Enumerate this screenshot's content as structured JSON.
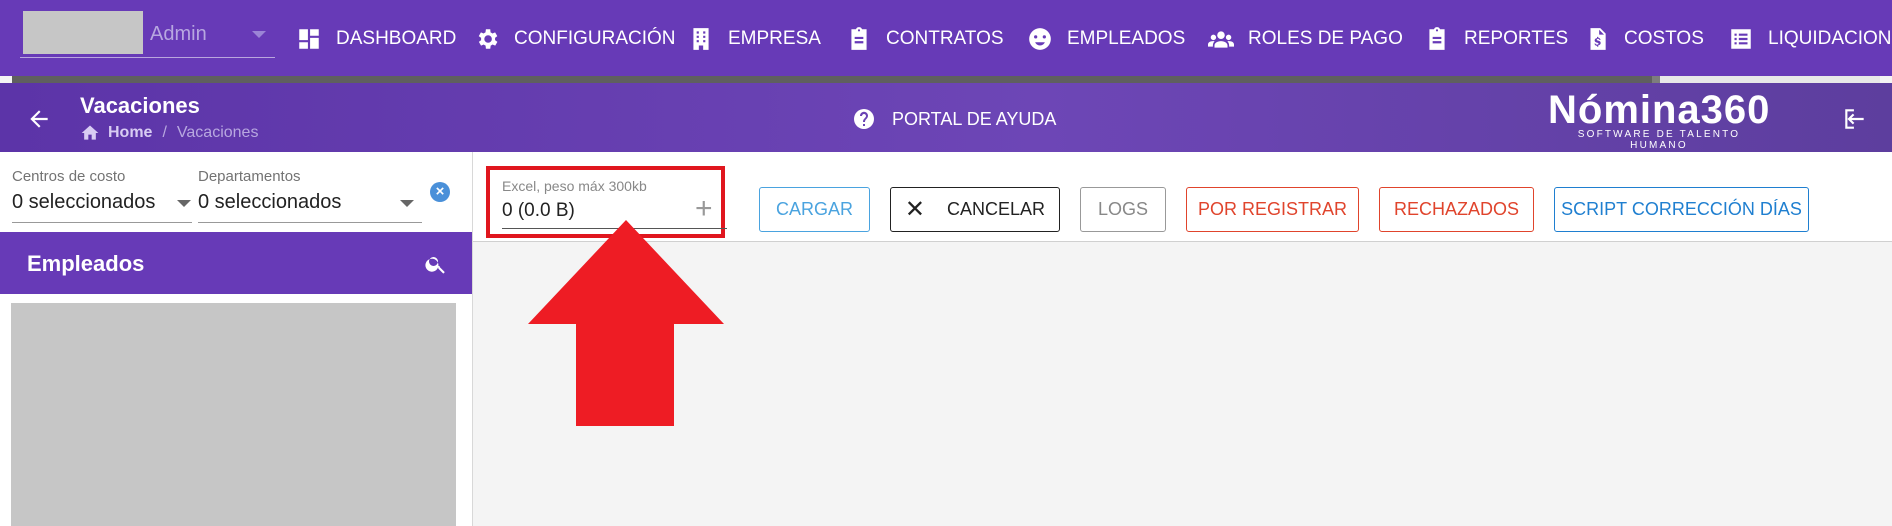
{
  "topnav": {
    "user_name": "Admin",
    "items": [
      {
        "label": "DASHBOARD",
        "icon": "dashboard-icon"
      },
      {
        "label": "CONFIGURACIÓN",
        "icon": "gear-icon"
      },
      {
        "label": "EMPRESA",
        "icon": "building-icon"
      },
      {
        "label": "CONTRATOS",
        "icon": "clipboard-icon"
      },
      {
        "label": "EMPLEADOS",
        "icon": "face-icon"
      },
      {
        "label": "ROLES DE PAGO",
        "icon": "group-icon"
      },
      {
        "label": "REPORTES",
        "icon": "clipboard-icon"
      },
      {
        "label": "COSTOS",
        "icon": "invoice-icon"
      },
      {
        "label": "LIQUIDACIONE",
        "icon": "list-icon"
      }
    ]
  },
  "header": {
    "title": "Vacaciones",
    "breadcrumb": {
      "home": "Home",
      "separator": "/",
      "current": "Vacaciones"
    },
    "help_label": "PORTAL DE AYUDA",
    "logo": {
      "main": "Nómina360",
      "sub": "SOFTWARE DE TALENTO HUMANO"
    }
  },
  "filters": {
    "centros": {
      "label": "Centros de costo",
      "value": "0 seleccionados"
    },
    "departamentos": {
      "label": "Departamentos",
      "value": "0 seleccionados"
    }
  },
  "employees": {
    "title": "Empleados"
  },
  "upload": {
    "label": "Excel, peso máx 300kb",
    "value": "0 (0.0 B)",
    "plus": "+"
  },
  "buttons": {
    "cargar": "CARGAR",
    "cancelar": "CANCELAR",
    "logs": "LOGS",
    "por_registrar": "POR REGISTRAR",
    "rechazados": "RECHAZADOS",
    "script": "SCRIPT CORRECCIÓN DÍAS"
  },
  "colors": {
    "primary": "#673ab7",
    "highlight": "#e0161e",
    "cargar": "#4aa3df",
    "danger": "#e0442c",
    "script": "#1f7fd0"
  }
}
